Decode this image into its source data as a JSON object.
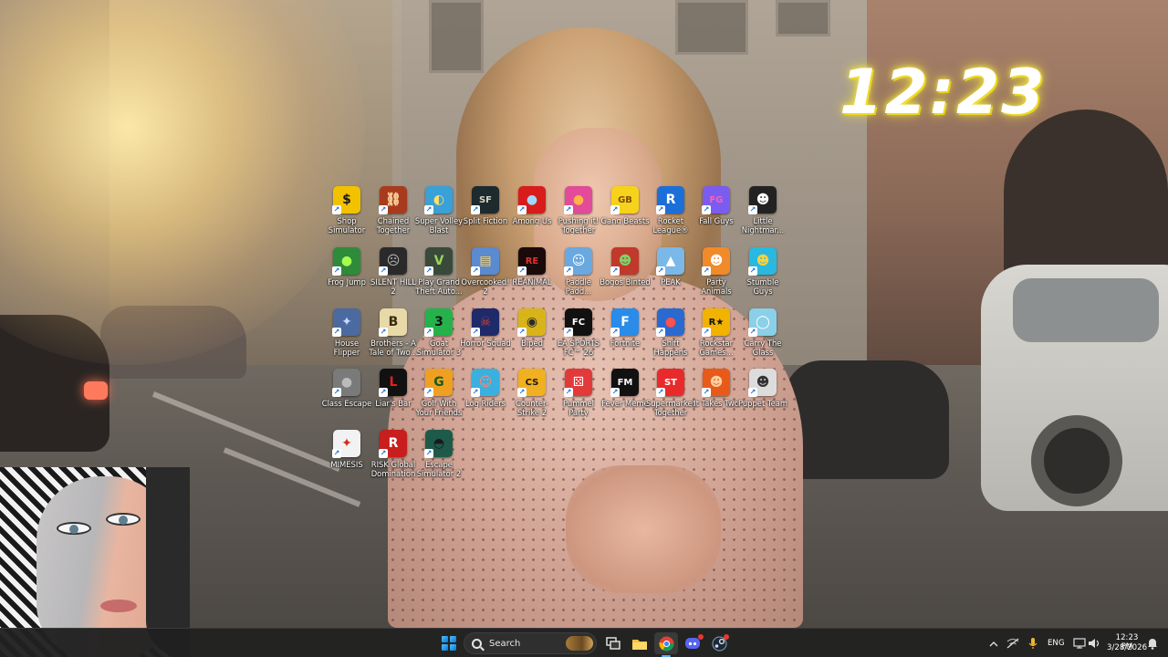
{
  "clock_widget": {
    "time": "12:23"
  },
  "desktop_icons": [
    {
      "id": "shop-simulator",
      "label": "Shop Simulator",
      "glyph": "$",
      "bg": "#f2c200",
      "fg": "#1a1a1a",
      "icon": "dollar-coin-icon"
    },
    {
      "id": "chained-together",
      "label": "Chained Together",
      "glyph": "⛓",
      "bg": "#a83a1e",
      "fg": "#ffd9a0",
      "icon": "chain-emblem-icon"
    },
    {
      "id": "super-volley-blast",
      "label": "Super Volley Blast",
      "glyph": "◐",
      "bg": "#3aa0d8",
      "fg": "#ffe066",
      "icon": "volleyball-icon"
    },
    {
      "id": "split-fiction",
      "label": "Split Fiction",
      "glyph": "SF",
      "bg": "#1d2a2e",
      "fg": "#d9d2c0",
      "icon": "split-fiction-icon"
    },
    {
      "id": "among-us",
      "label": "Among Us",
      "glyph": "●",
      "bg": "#d81c1c",
      "fg": "#9fd8ff",
      "icon": "crewmate-icon"
    },
    {
      "id": "pushing-it-together",
      "label": "Pushing it! Together",
      "glyph": "●",
      "bg": "#e24a9a",
      "fg": "#ffb347",
      "icon": "pushing-blob-icon"
    },
    {
      "id": "gang-beasts",
      "label": "Gang Beasts",
      "glyph": "GB",
      "bg": "#f7d21a",
      "fg": "#7b4b10",
      "icon": "gang-beasts-logo-icon"
    },
    {
      "id": "rocket-league",
      "label": "Rocket League®",
      "glyph": "R",
      "bg": "#1c6fd8",
      "fg": "#ffffff",
      "icon": "rocket-league-icon"
    },
    {
      "id": "fall-guys",
      "label": "Fall Guys",
      "glyph": "FG",
      "bg": "#7b5cf0",
      "fg": "#ff5fb0",
      "icon": "fall-guys-icon"
    },
    {
      "id": "little-nightmares",
      "label": "Little Nightmar...",
      "glyph": "☻",
      "bg": "#222222",
      "fg": "#ffffff",
      "icon": "little-nightmares-icon"
    },
    {
      "id": "frog-jump",
      "label": "Frog Jump",
      "glyph": "●",
      "bg": "#2e8b3a",
      "fg": "#a6ff4d",
      "icon": "frog-icon"
    },
    {
      "id": "silent-hill-2",
      "label": "SILENT HILL 2",
      "glyph": "☹",
      "bg": "#2a2a2a",
      "fg": "#bbbbbb",
      "icon": "silent-hill-face-icon"
    },
    {
      "id": "gta-v",
      "label": "Play Grand Theft Auto...",
      "glyph": "V",
      "bg": "#3a4a3a",
      "fg": "#9bd35a",
      "icon": "gta-five-icon"
    },
    {
      "id": "overcooked-2",
      "label": "Overcooked! 2",
      "glyph": "▤",
      "bg": "#5a8ad0",
      "fg": "#ffd36a",
      "icon": "overcooked-icon"
    },
    {
      "id": "reanimal",
      "label": "REANIMAL",
      "glyph": "RE",
      "bg": "#1a0a0a",
      "fg": "#e23030",
      "icon": "reanimal-icon"
    },
    {
      "id": "paddle-paddle",
      "label": "Paddle Padd...",
      "glyph": "☺",
      "bg": "#6aa8e0",
      "fg": "#ffffff",
      "icon": "paddle-character-icon"
    },
    {
      "id": "bogos-binted",
      "label": "Bogos Binted",
      "glyph": "☻",
      "bg": "#c0392b",
      "fg": "#7bd46a",
      "icon": "alien-head-icon"
    },
    {
      "id": "peak",
      "label": "PEAK",
      "glyph": "▲",
      "bg": "#7ab8e8",
      "fg": "#ffffff",
      "icon": "mountain-peak-icon"
    },
    {
      "id": "party-animals",
      "label": "Party Animals",
      "glyph": "☻",
      "bg": "#f08a2a",
      "fg": "#ffffff",
      "icon": "corgi-icon"
    },
    {
      "id": "stumble-guys",
      "label": "Stumble Guys",
      "glyph": "☻",
      "bg": "#28b8e0",
      "fg": "#ffd23a",
      "icon": "stumble-guy-icon"
    },
    {
      "id": "house-flipper",
      "label": "House Flipper",
      "glyph": "✦",
      "bg": "#4a6aa0",
      "fg": "#c8d8ff",
      "icon": "house-flipper-icon"
    },
    {
      "id": "brothers",
      "label": "Brothers - A Tale of Two...",
      "glyph": "B",
      "bg": "#e8d9a8",
      "fg": "#3a2a10",
      "icon": "brothers-emblem-icon"
    },
    {
      "id": "goat-simulator-3",
      "label": "Goat Simulator 3",
      "glyph": "3",
      "bg": "#25b24a",
      "fg": "#111111",
      "icon": "goat-three-icon"
    },
    {
      "id": "horror-squad",
      "label": "Horror Squad",
      "glyph": "☠",
      "bg": "#1e2a6a",
      "fg": "#d04040",
      "icon": "horror-squad-icon"
    },
    {
      "id": "biped",
      "label": "Biped",
      "glyph": "◉",
      "bg": "#d8b41a",
      "fg": "#2a2a2a",
      "icon": "biped-robot-icon"
    },
    {
      "id": "ea-fc-26",
      "label": "EA SPORTS FC™ 26",
      "glyph": "FC",
      "bg": "#111111",
      "fg": "#ffffff",
      "icon": "ea-fc-icon"
    },
    {
      "id": "fortnite",
      "label": "Fortnite",
      "glyph": "F",
      "bg": "#2a8be8",
      "fg": "#ffffff",
      "icon": "fortnite-icon"
    },
    {
      "id": "shift-happens",
      "label": "Shift Happens",
      "glyph": "●",
      "bg": "#2a6ad0",
      "fg": "#ff5050",
      "icon": "shift-happens-icon"
    },
    {
      "id": "rockstar-games",
      "label": "Rockstar Games...",
      "glyph": "R★",
      "bg": "#f2b200",
      "fg": "#111111",
      "icon": "rockstar-logo-icon"
    },
    {
      "id": "carry-the-glass",
      "label": "Carry The Glass",
      "glyph": "◯",
      "bg": "#8ad0e8",
      "fg": "#ffffff",
      "icon": "glass-ball-icon"
    },
    {
      "id": "class-escape",
      "label": "Class Escape",
      "glyph": "●",
      "bg": "#7a7a7a",
      "fg": "#bbbbbb",
      "icon": "class-escape-icon"
    },
    {
      "id": "liars-bar",
      "label": "Liar's Bar",
      "glyph": "L",
      "bg": "#111111",
      "fg": "#e02020",
      "icon": "liars-bar-icon"
    },
    {
      "id": "golf-with-your-friends",
      "label": "Golf With Your Friends",
      "glyph": "G",
      "bg": "#f0a020",
      "fg": "#1a5a1a",
      "icon": "golf-letter-g-icon"
    },
    {
      "id": "log-riders",
      "label": "Log Riders",
      "glyph": "☺",
      "bg": "#3ab0e0",
      "fg": "#ff8a70",
      "icon": "log-riders-icon"
    },
    {
      "id": "counter-strike-2",
      "label": "Counter-Strike 2",
      "glyph": "CS",
      "bg": "#f0b020",
      "fg": "#1a1a1a",
      "icon": "counter-strike-icon"
    },
    {
      "id": "pummel-party",
      "label": "Pummel Party",
      "glyph": "⚄",
      "bg": "#e23a3a",
      "fg": "#ffffff",
      "icon": "dice-icon"
    },
    {
      "id": "fever-meme",
      "label": "Fever Meme",
      "glyph": "FM",
      "bg": "#111111",
      "fg": "#ffffff",
      "icon": "fever-meme-icon"
    },
    {
      "id": "supermarket-together",
      "label": "Supermarket Together",
      "glyph": "ST",
      "bg": "#e82a2a",
      "fg": "#ffffff",
      "icon": "supermarket-together-icon"
    },
    {
      "id": "it-takes-two",
      "label": "It Takes Two",
      "glyph": "☻",
      "bg": "#e85a1a",
      "fg": "#ffd0a0",
      "icon": "it-takes-two-icon"
    },
    {
      "id": "puppet-team",
      "label": "Puppet Team",
      "glyph": "☻",
      "bg": "#dcdcdc",
      "fg": "#333333",
      "icon": "puppet-team-icon"
    },
    {
      "id": "mimesis",
      "label": "MIMESIS",
      "glyph": "✦",
      "bg": "#f2f2f2",
      "fg": "#d03020",
      "icon": "mimesis-bird-icon"
    },
    {
      "id": "risk-global-domination",
      "label": "RISK Global Domination",
      "glyph": "R",
      "bg": "#c81e1e",
      "fg": "#ffffff",
      "icon": "risk-letter-r-icon"
    },
    {
      "id": "escape-simulator-2",
      "label": "Escape Simulator 2",
      "glyph": "◓",
      "bg": "#1e5a4a",
      "fg": "#1a1a1a",
      "icon": "keyhole-icon"
    }
  ],
  "taskbar": {
    "start": "Start",
    "search_placeholder": "Search",
    "tray": {
      "language": "ENG",
      "time": "12:23 PM",
      "date": "3/28/2026"
    }
  }
}
